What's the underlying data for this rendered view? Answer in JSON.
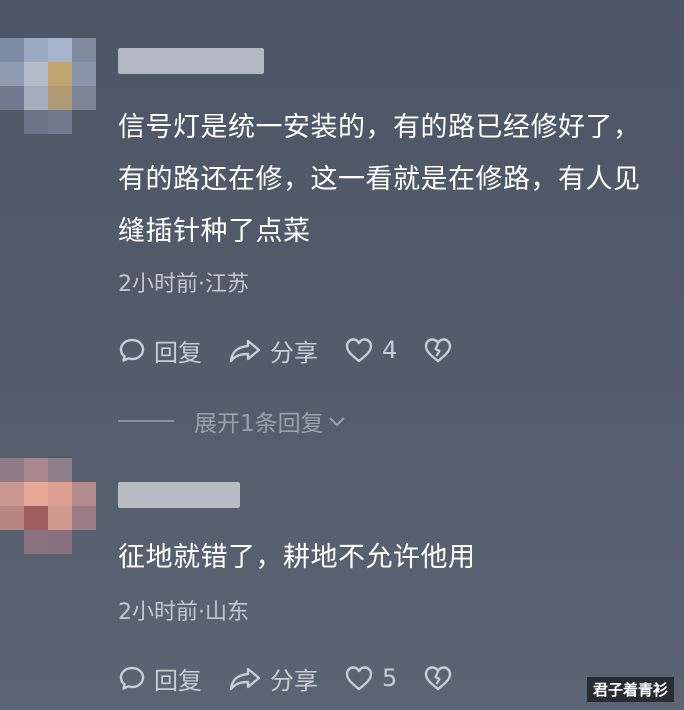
{
  "comments": [
    {
      "text_lines": [
        "信号灯是统一安装的，有的路已经修好了，",
        "有的路还在修，这一看就是在修路，有人见",
        "缝插针种了点菜"
      ],
      "meta": "2小时前·江苏",
      "reply_label": "回复",
      "share_label": "分享",
      "likes": "4"
    },
    {
      "text_lines": [
        "征地就错了，耕地不允许他用"
      ],
      "meta": "2小时前·山东",
      "reply_label": "回复",
      "share_label": "分享",
      "likes": "5"
    }
  ],
  "expand_label": "展开1条回复",
  "watermark": "君子着青衫",
  "colors": {
    "background": "#525b6a",
    "text": "#ffffff",
    "meta": "#c2c7d0"
  }
}
